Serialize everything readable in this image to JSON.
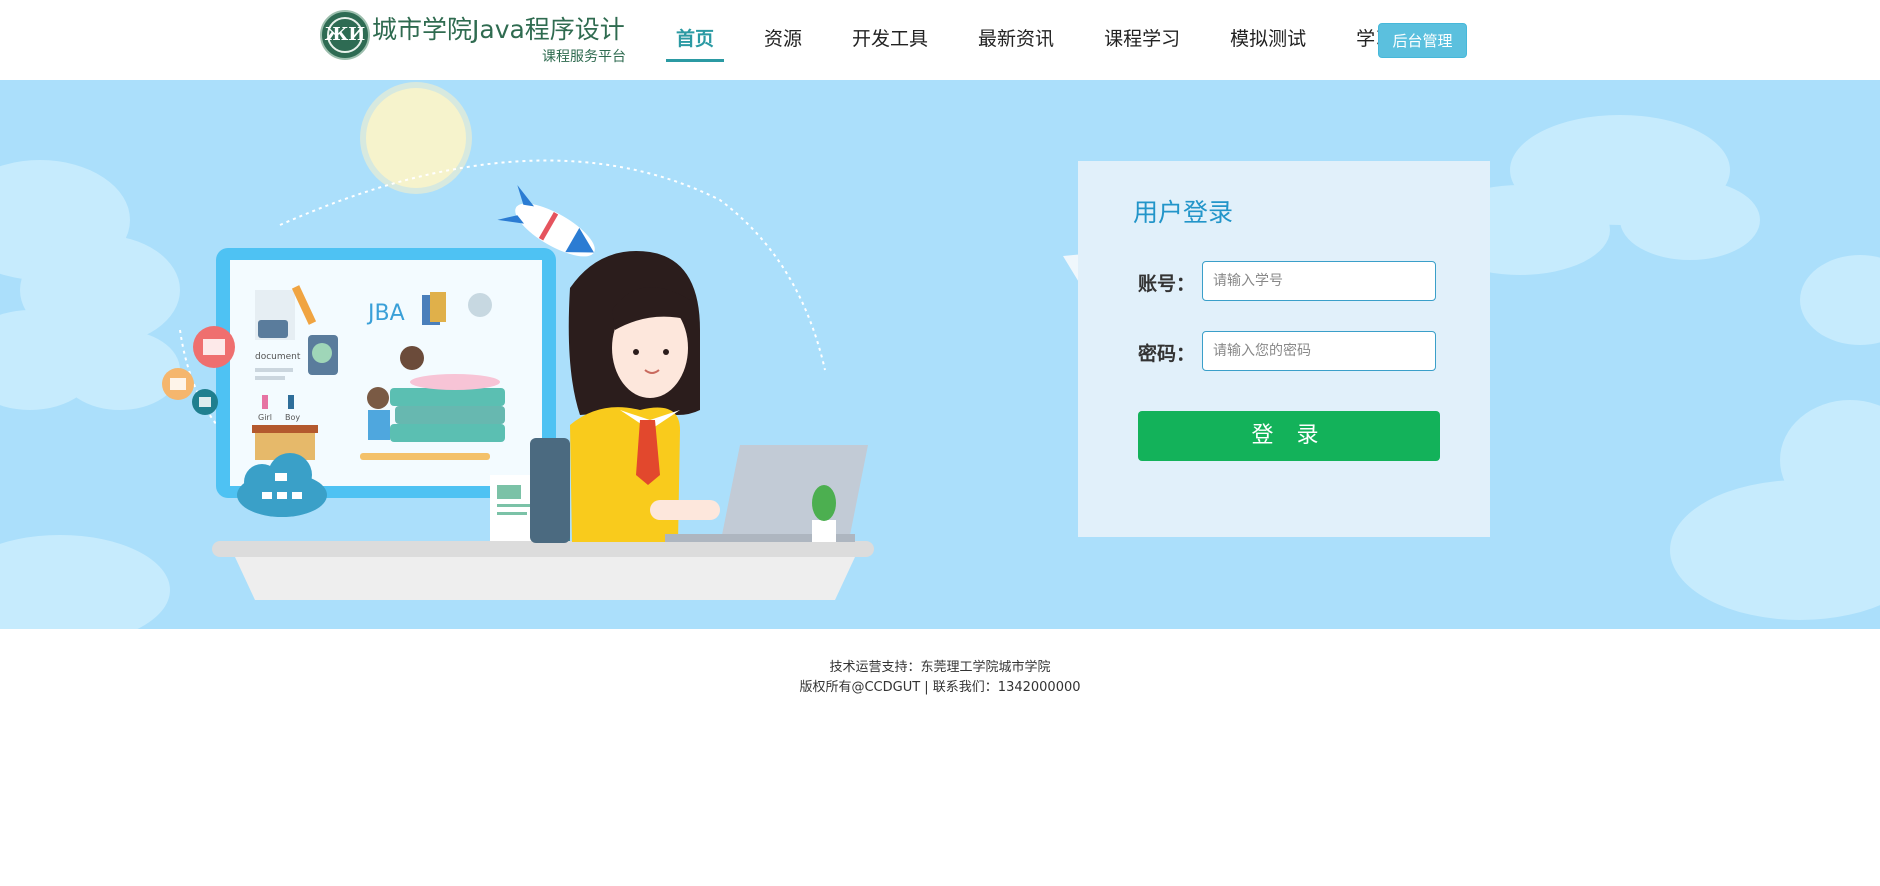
{
  "header": {
    "logo_glyph": "ЖИ",
    "site_title": "城市学院Java程序设计",
    "site_subtitle": "课程服务平台",
    "nav": [
      {
        "label": "首页",
        "active": true
      },
      {
        "label": "资源"
      },
      {
        "label": "开发工具"
      },
      {
        "label": "最新资讯"
      },
      {
        "label": "课程学习"
      },
      {
        "label": "模拟测试"
      },
      {
        "label": "学习讨论"
      }
    ],
    "admin_button": "后台管理"
  },
  "login": {
    "title": "用户登录",
    "account_label": "账号：",
    "account_placeholder": "请输入学号",
    "password_label": "密码：",
    "password_placeholder": "请输入您的密码",
    "submit_label": "登 录"
  },
  "illustration": {
    "board_text": "JBA",
    "book_text": "document",
    "girl_label": "Girl",
    "boy_label": "Boy"
  },
  "footer": {
    "line1": "技术运营支持：东莞理工学院城市学院",
    "line2": "版权所有@CCDGUT | 联系我们：1342000000"
  },
  "colors": {
    "accent": "#2b9aa3",
    "banner_bg": "#abdffb",
    "login_button": "#13b25a",
    "admin_button": "#5bc0de"
  }
}
